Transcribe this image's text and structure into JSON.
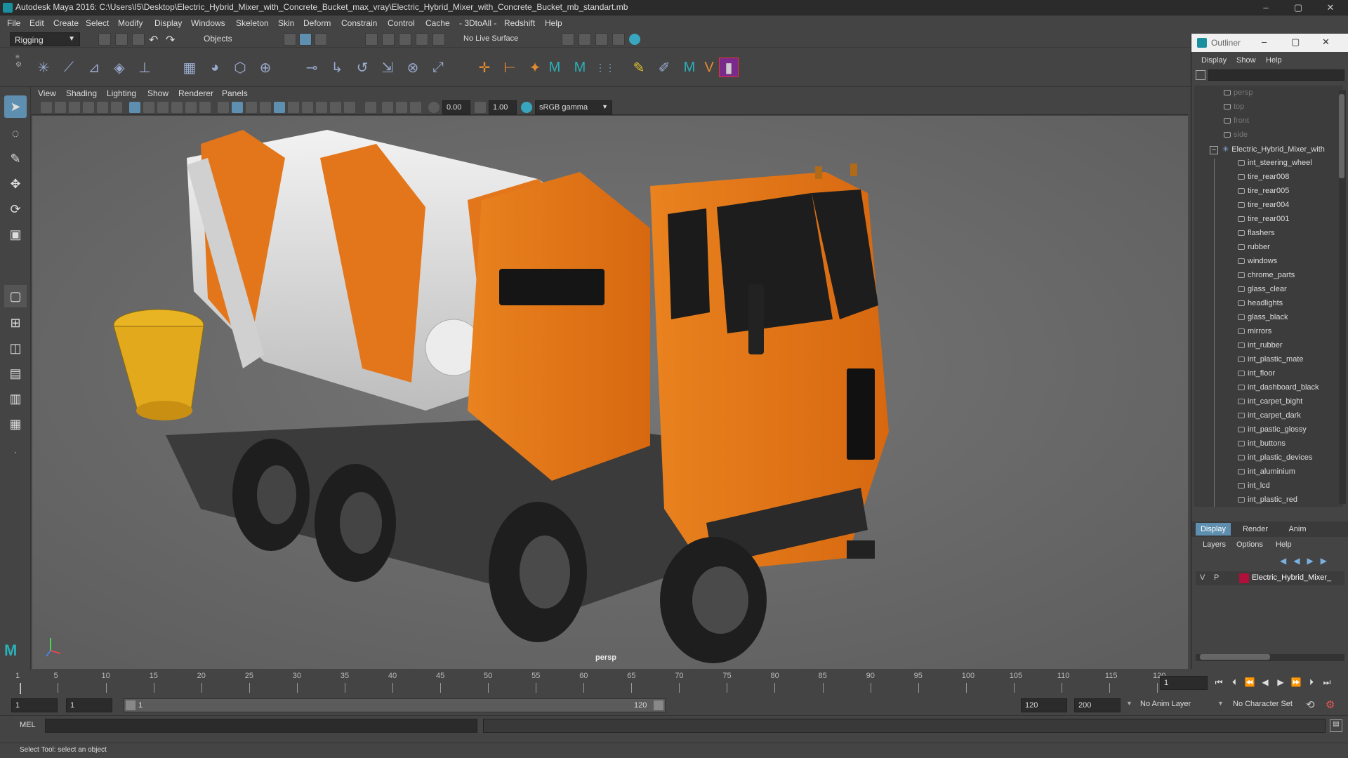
{
  "titlebar": {
    "title": "Autodesk Maya 2016: C:\\Users\\I5\\Desktop\\Electric_Hybrid_Mixer_with_Concrete_Bucket_max_vray\\Electric_Hybrid_Mixer_with_Concrete_Bucket_mb_standart.mb",
    "minimize": "–",
    "maximize": "▢",
    "close": "✕"
  },
  "menubar": [
    "File",
    "Edit",
    "Create",
    "Select",
    "Modify",
    "Display",
    "Windows",
    "Skeleton",
    "Skin",
    "Deform",
    "Constrain",
    "Control",
    "Cache",
    "- 3DtoAll -",
    "Redshift",
    "Help"
  ],
  "statusline": {
    "mode": "Rigging",
    "selection_mode": "Objects",
    "live_surface": "No Live Surface"
  },
  "viewport_menu": [
    "View",
    "Shading",
    "Lighting",
    "Show",
    "Renderer",
    "Panels"
  ],
  "viewport_toolbar": {
    "exposure": "0.00",
    "gamma": "1.00",
    "colorspace": "sRGB gamma"
  },
  "viewport": {
    "camera_label": "persp"
  },
  "outliner": {
    "title": "Outliner",
    "menu": [
      "Display",
      "Show",
      "Help"
    ],
    "cameras": [
      "persp",
      "top",
      "front",
      "side"
    ],
    "root": "Electric_Hybrid_Mixer_with",
    "children": [
      "int_steering_wheel",
      "tire_rear008",
      "tire_rear005",
      "tire_rear004",
      "tire_rear001",
      "flashers",
      "rubber",
      "windows",
      "chrome_parts",
      "glass_clear",
      "headlights",
      "glass_black",
      "mirrors",
      "int_rubber",
      "int_plastic_mate",
      "int_floor",
      "int_dashboard_black",
      "int_carpet_bight",
      "int_carpet_dark",
      "int_pastic_glossy",
      "int_buttons",
      "int_plastic_devices",
      "int_aluminium",
      "int_lcd",
      "int_plastic_red"
    ]
  },
  "layer_editor": {
    "tabs": [
      "Display",
      "Render",
      "Anim"
    ],
    "menu": [
      "Layers",
      "Options",
      "Help"
    ],
    "layer": {
      "v": "V",
      "p": "P",
      "name": "Electric_Hybrid_Mixer_",
      "color": "#b0103a"
    }
  },
  "timeline": {
    "ticks": [
      "1",
      "5",
      "10",
      "15",
      "20",
      "25",
      "30",
      "35",
      "40",
      "45",
      "50",
      "55",
      "60",
      "65",
      "70",
      "75",
      "80",
      "85",
      "90",
      "95",
      "100",
      "105",
      "110",
      "115",
      "120"
    ],
    "current_frame": "1"
  },
  "range": {
    "start": "1",
    "playback_start": "1",
    "slider_start": "1",
    "slider_end": "120",
    "playback_end": "120",
    "end": "200",
    "anim_layer": "No Anim Layer",
    "character_set": "No Character Set"
  },
  "cmdline": {
    "label": "MEL"
  },
  "helpline": {
    "text": "Select Tool: select an object"
  },
  "colors": {
    "accent": "#1a8fa0",
    "truck_orange": "#e3761a",
    "bucket_yellow": "#e9b423"
  }
}
